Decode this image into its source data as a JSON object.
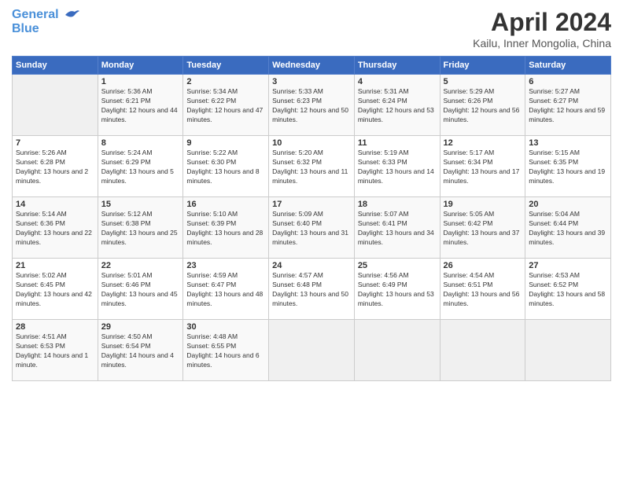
{
  "header": {
    "logo_line1": "General",
    "logo_line2": "Blue",
    "month_year": "April 2024",
    "location": "Kailu, Inner Mongolia, China"
  },
  "weekdays": [
    "Sunday",
    "Monday",
    "Tuesday",
    "Wednesday",
    "Thursday",
    "Friday",
    "Saturday"
  ],
  "weeks": [
    [
      {
        "day": "",
        "sunrise": "",
        "sunset": "",
        "daylight": ""
      },
      {
        "day": "1",
        "sunrise": "Sunrise: 5:36 AM",
        "sunset": "Sunset: 6:21 PM",
        "daylight": "Daylight: 12 hours and 44 minutes."
      },
      {
        "day": "2",
        "sunrise": "Sunrise: 5:34 AM",
        "sunset": "Sunset: 6:22 PM",
        "daylight": "Daylight: 12 hours and 47 minutes."
      },
      {
        "day": "3",
        "sunrise": "Sunrise: 5:33 AM",
        "sunset": "Sunset: 6:23 PM",
        "daylight": "Daylight: 12 hours and 50 minutes."
      },
      {
        "day": "4",
        "sunrise": "Sunrise: 5:31 AM",
        "sunset": "Sunset: 6:24 PM",
        "daylight": "Daylight: 12 hours and 53 minutes."
      },
      {
        "day": "5",
        "sunrise": "Sunrise: 5:29 AM",
        "sunset": "Sunset: 6:26 PM",
        "daylight": "Daylight: 12 hours and 56 minutes."
      },
      {
        "day": "6",
        "sunrise": "Sunrise: 5:27 AM",
        "sunset": "Sunset: 6:27 PM",
        "daylight": "Daylight: 12 hours and 59 minutes."
      }
    ],
    [
      {
        "day": "7",
        "sunrise": "Sunrise: 5:26 AM",
        "sunset": "Sunset: 6:28 PM",
        "daylight": "Daylight: 13 hours and 2 minutes."
      },
      {
        "day": "8",
        "sunrise": "Sunrise: 5:24 AM",
        "sunset": "Sunset: 6:29 PM",
        "daylight": "Daylight: 13 hours and 5 minutes."
      },
      {
        "day": "9",
        "sunrise": "Sunrise: 5:22 AM",
        "sunset": "Sunset: 6:30 PM",
        "daylight": "Daylight: 13 hours and 8 minutes."
      },
      {
        "day": "10",
        "sunrise": "Sunrise: 5:20 AM",
        "sunset": "Sunset: 6:32 PM",
        "daylight": "Daylight: 13 hours and 11 minutes."
      },
      {
        "day": "11",
        "sunrise": "Sunrise: 5:19 AM",
        "sunset": "Sunset: 6:33 PM",
        "daylight": "Daylight: 13 hours and 14 minutes."
      },
      {
        "day": "12",
        "sunrise": "Sunrise: 5:17 AM",
        "sunset": "Sunset: 6:34 PM",
        "daylight": "Daylight: 13 hours and 17 minutes."
      },
      {
        "day": "13",
        "sunrise": "Sunrise: 5:15 AM",
        "sunset": "Sunset: 6:35 PM",
        "daylight": "Daylight: 13 hours and 19 minutes."
      }
    ],
    [
      {
        "day": "14",
        "sunrise": "Sunrise: 5:14 AM",
        "sunset": "Sunset: 6:36 PM",
        "daylight": "Daylight: 13 hours and 22 minutes."
      },
      {
        "day": "15",
        "sunrise": "Sunrise: 5:12 AM",
        "sunset": "Sunset: 6:38 PM",
        "daylight": "Daylight: 13 hours and 25 minutes."
      },
      {
        "day": "16",
        "sunrise": "Sunrise: 5:10 AM",
        "sunset": "Sunset: 6:39 PM",
        "daylight": "Daylight: 13 hours and 28 minutes."
      },
      {
        "day": "17",
        "sunrise": "Sunrise: 5:09 AM",
        "sunset": "Sunset: 6:40 PM",
        "daylight": "Daylight: 13 hours and 31 minutes."
      },
      {
        "day": "18",
        "sunrise": "Sunrise: 5:07 AM",
        "sunset": "Sunset: 6:41 PM",
        "daylight": "Daylight: 13 hours and 34 minutes."
      },
      {
        "day": "19",
        "sunrise": "Sunrise: 5:05 AM",
        "sunset": "Sunset: 6:42 PM",
        "daylight": "Daylight: 13 hours and 37 minutes."
      },
      {
        "day": "20",
        "sunrise": "Sunrise: 5:04 AM",
        "sunset": "Sunset: 6:44 PM",
        "daylight": "Daylight: 13 hours and 39 minutes."
      }
    ],
    [
      {
        "day": "21",
        "sunrise": "Sunrise: 5:02 AM",
        "sunset": "Sunset: 6:45 PM",
        "daylight": "Daylight: 13 hours and 42 minutes."
      },
      {
        "day": "22",
        "sunrise": "Sunrise: 5:01 AM",
        "sunset": "Sunset: 6:46 PM",
        "daylight": "Daylight: 13 hours and 45 minutes."
      },
      {
        "day": "23",
        "sunrise": "Sunrise: 4:59 AM",
        "sunset": "Sunset: 6:47 PM",
        "daylight": "Daylight: 13 hours and 48 minutes."
      },
      {
        "day": "24",
        "sunrise": "Sunrise: 4:57 AM",
        "sunset": "Sunset: 6:48 PM",
        "daylight": "Daylight: 13 hours and 50 minutes."
      },
      {
        "day": "25",
        "sunrise": "Sunrise: 4:56 AM",
        "sunset": "Sunset: 6:49 PM",
        "daylight": "Daylight: 13 hours and 53 minutes."
      },
      {
        "day": "26",
        "sunrise": "Sunrise: 4:54 AM",
        "sunset": "Sunset: 6:51 PM",
        "daylight": "Daylight: 13 hours and 56 minutes."
      },
      {
        "day": "27",
        "sunrise": "Sunrise: 4:53 AM",
        "sunset": "Sunset: 6:52 PM",
        "daylight": "Daylight: 13 hours and 58 minutes."
      }
    ],
    [
      {
        "day": "28",
        "sunrise": "Sunrise: 4:51 AM",
        "sunset": "Sunset: 6:53 PM",
        "daylight": "Daylight: 14 hours and 1 minute."
      },
      {
        "day": "29",
        "sunrise": "Sunrise: 4:50 AM",
        "sunset": "Sunset: 6:54 PM",
        "daylight": "Daylight: 14 hours and 4 minutes."
      },
      {
        "day": "30",
        "sunrise": "Sunrise: 4:48 AM",
        "sunset": "Sunset: 6:55 PM",
        "daylight": "Daylight: 14 hours and 6 minutes."
      },
      {
        "day": "",
        "sunrise": "",
        "sunset": "",
        "daylight": ""
      },
      {
        "day": "",
        "sunrise": "",
        "sunset": "",
        "daylight": ""
      },
      {
        "day": "",
        "sunrise": "",
        "sunset": "",
        "daylight": ""
      },
      {
        "day": "",
        "sunrise": "",
        "sunset": "",
        "daylight": ""
      }
    ]
  ]
}
